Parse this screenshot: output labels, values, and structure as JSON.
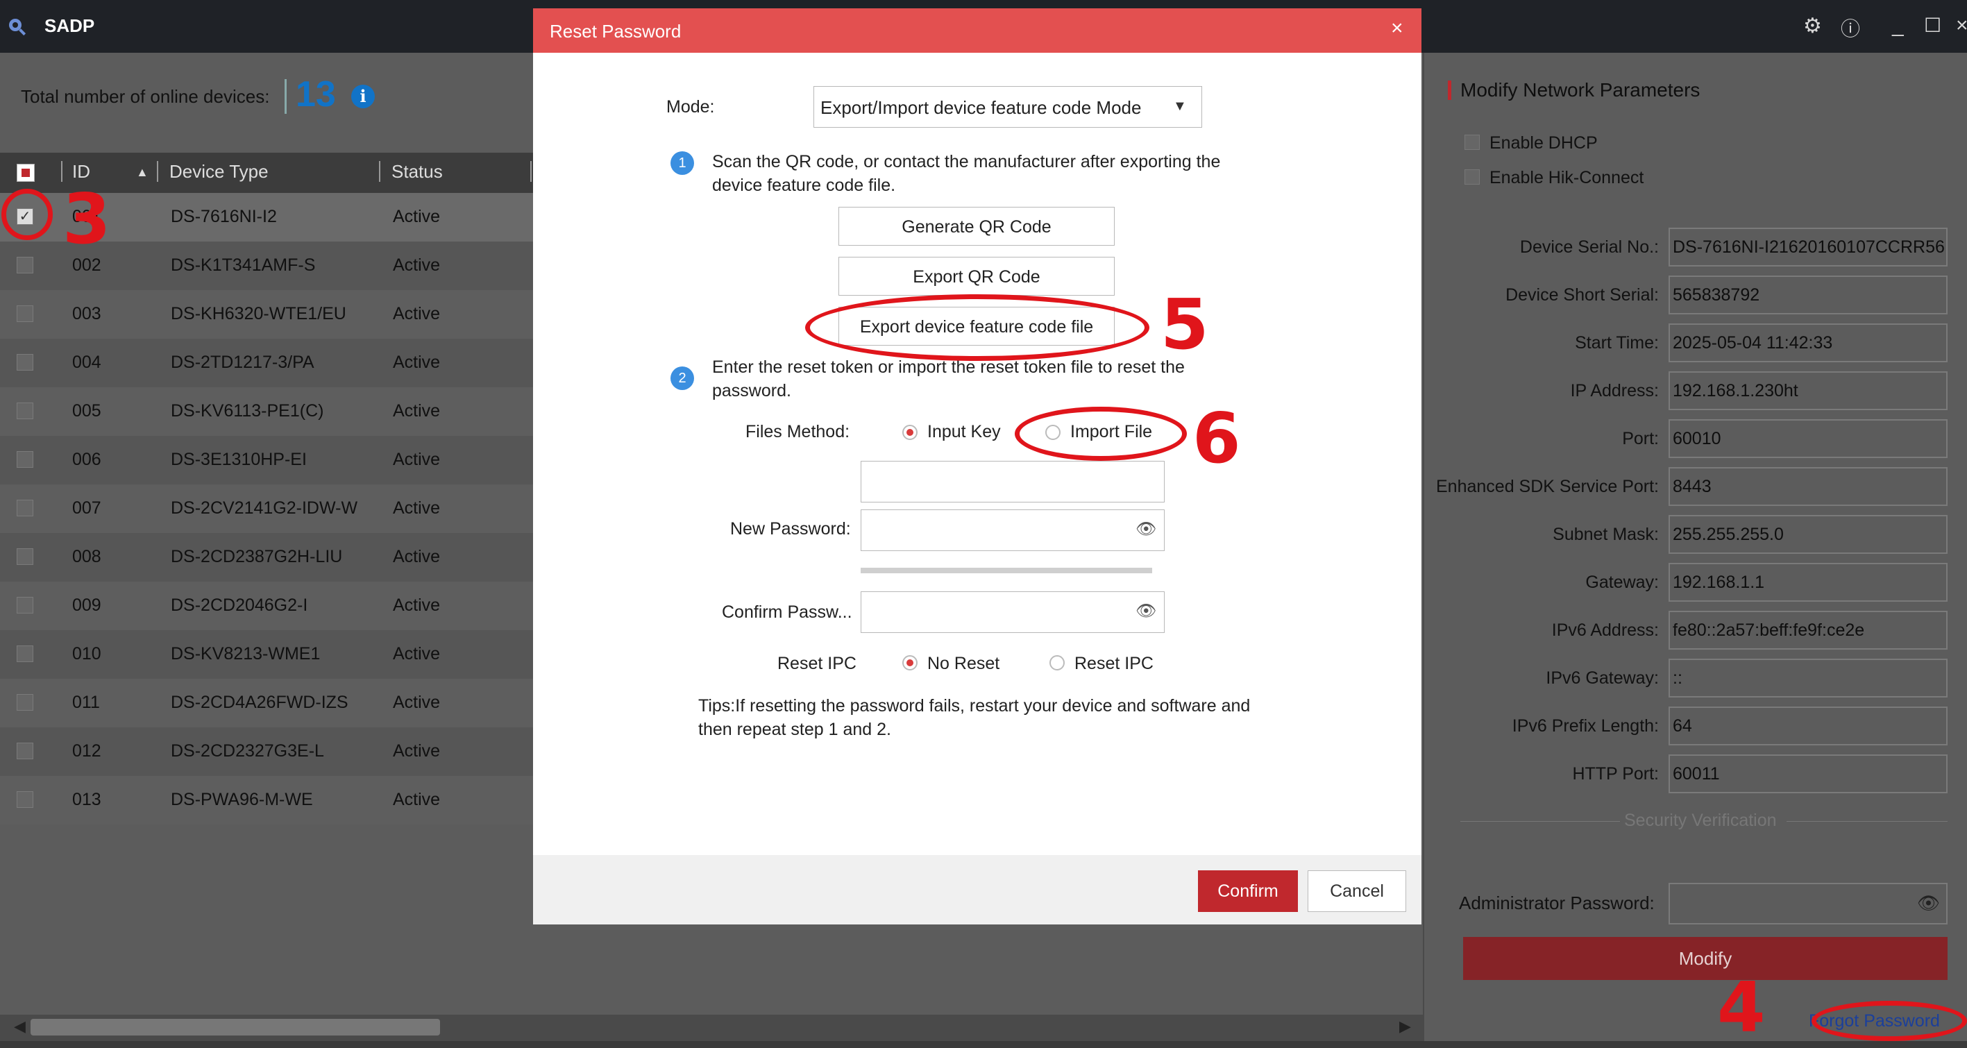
{
  "app": {
    "title": "SADP"
  },
  "left": {
    "total_label": "Total number of online devices:",
    "total_count": "13",
    "headers": {
      "id": "ID",
      "type": "Device Type",
      "status": "Status"
    },
    "rows": [
      {
        "id": "001",
        "type": "DS-7616NI-I2",
        "status": "Active",
        "checked": true
      },
      {
        "id": "002",
        "type": "DS-K1T341AMF-S",
        "status": "Active"
      },
      {
        "id": "003",
        "type": "DS-KH6320-WTE1/EU",
        "status": "Active"
      },
      {
        "id": "004",
        "type": "DS-2TD1217-3/PA",
        "status": "Active"
      },
      {
        "id": "005",
        "type": "DS-KV6113-PE1(C)",
        "status": "Active"
      },
      {
        "id": "006",
        "type": "DS-3E1310HP-EI",
        "status": "Active"
      },
      {
        "id": "007",
        "type": "DS-2CV2141G2-IDW-W",
        "status": "Active"
      },
      {
        "id": "008",
        "type": "DS-2CD2387G2H-LIU",
        "status": "Active"
      },
      {
        "id": "009",
        "type": "DS-2CD2046G2-I",
        "status": "Active"
      },
      {
        "id": "010",
        "type": "DS-KV8213-WME1",
        "status": "Active"
      },
      {
        "id": "011",
        "type": "DS-2CD4A26FWD-IZS",
        "status": "Active"
      },
      {
        "id": "012",
        "type": "DS-2CD2327G3E-L",
        "status": "Active"
      },
      {
        "id": "013",
        "type": "DS-PWA96-M-WE",
        "status": "Active"
      }
    ]
  },
  "right": {
    "title": "Modify Network Parameters",
    "enable_dhcp": "Enable DHCP",
    "enable_hik": "Enable Hik-Connect",
    "fields": [
      {
        "label": "Device Serial No.:",
        "value": "DS-7616NI-I21620160107CCRR56"
      },
      {
        "label": "Device Short Serial:",
        "value": "565838792"
      },
      {
        "label": "Start Time:",
        "value": "2025-05-04 11:42:33"
      },
      {
        "label": "IP Address:",
        "value": "192.168.1.230ht"
      },
      {
        "label": "Port:",
        "value": "60010"
      },
      {
        "label": "Enhanced SDK Service Port:",
        "value": "8443"
      },
      {
        "label": "Subnet Mask:",
        "value": "255.255.255.0"
      },
      {
        "label": "Gateway:",
        "value": "192.168.1.1"
      },
      {
        "label": "IPv6 Address:",
        "value": "fe80::2a57:beff:fe9f:ce2e"
      },
      {
        "label": "IPv6 Gateway:",
        "value": "::"
      },
      {
        "label": "IPv6 Prefix Length:",
        "value": "64"
      },
      {
        "label": "HTTP Port:",
        "value": "60011"
      }
    ],
    "security_label": "Security Verification",
    "admin_label": "Administrator Password:",
    "modify_label": "Modify",
    "forgot_label": "Forgot Password"
  },
  "modal": {
    "title": "Reset Password",
    "close": "×",
    "mode_label": "Mode:",
    "mode_value": "Export/Import device feature code Mode",
    "step1_num": "1",
    "step1_text_1": "Scan the QR code, or contact the manufacturer after exporting the",
    "step1_text_2": "device feature code file.",
    "btn_generate": "Generate QR Code",
    "btn_export_qr": "Export QR Code",
    "btn_export_file": "Export device feature code file",
    "step2_num": "2",
    "step2_text_1": "Enter the reset token or import the reset token file to reset the",
    "step2_text_2": "password.",
    "files_method_label": "Files Method:",
    "opt_input_key": "Input Key",
    "opt_import_file": "Import File",
    "new_password_label": "New Password:",
    "confirm_password_label": "Confirm Passw...",
    "reset_ipc_label": "Reset IPC",
    "opt_no_reset": "No Reset",
    "opt_reset_ipc": "Reset IPC",
    "tips_1": "Tips:If resetting the password fails, restart your device and software and",
    "tips_2": "then repeat step 1 and 2.",
    "confirm": "Confirm",
    "cancel": "Cancel"
  },
  "annotations": {
    "a3": "3",
    "a4": "4",
    "a5": "5",
    "a6": "6"
  },
  "colors": {
    "accent_red": "#c0282d",
    "modal_header": "#e35050",
    "count_blue": "#1173c7",
    "annotation_red": "#e0151b"
  }
}
